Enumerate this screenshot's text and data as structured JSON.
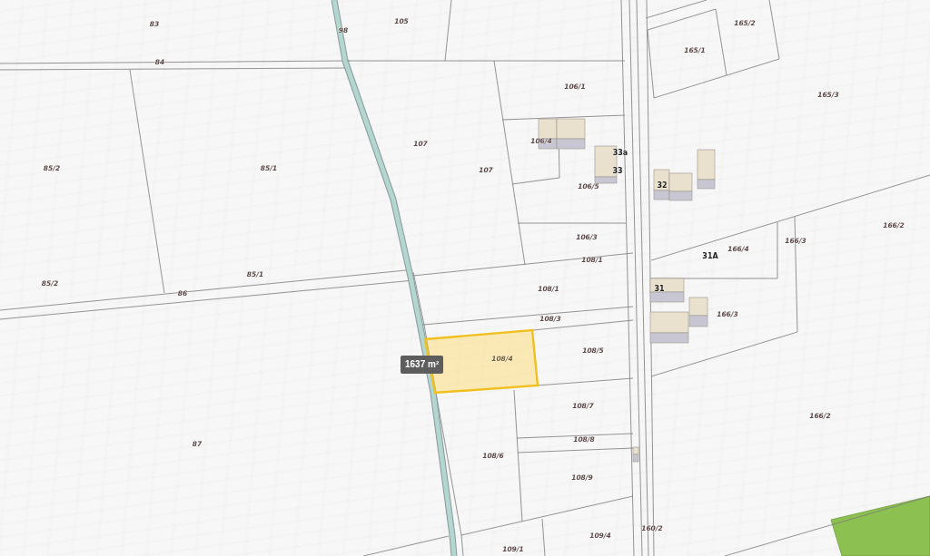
{
  "map": {
    "parcels": [
      {
        "label": "83",
        "selected": false
      },
      {
        "label": "105",
        "selected": false
      },
      {
        "label": "165/2",
        "selected": false
      },
      {
        "label": "98",
        "selected": false
      },
      {
        "label": "165/1",
        "selected": false
      },
      {
        "label": "84",
        "selected": false
      },
      {
        "label": "106/1",
        "selected": false
      },
      {
        "label": "165/3",
        "selected": false
      },
      {
        "label": "106/4",
        "selected": false
      },
      {
        "label": "107",
        "selected": false
      },
      {
        "label": "85/2",
        "selected": false
      },
      {
        "label": "85/1",
        "selected": false
      },
      {
        "label": "107",
        "selected": false
      },
      {
        "label": "106/5",
        "selected": false
      },
      {
        "label": "166/2",
        "selected": false
      },
      {
        "label": "106/3",
        "selected": false
      },
      {
        "label": "166/3",
        "selected": false
      },
      {
        "label": "166/4",
        "selected": false
      },
      {
        "label": "108/1",
        "selected": false
      },
      {
        "label": "85/1",
        "selected": false
      },
      {
        "label": "85/2",
        "selected": false
      },
      {
        "label": "108/1",
        "selected": false
      },
      {
        "label": "86",
        "selected": false
      },
      {
        "label": "166/3",
        "selected": false
      },
      {
        "label": "108/3",
        "selected": false
      },
      {
        "label": "108/5",
        "selected": false
      },
      {
        "label": "108/4",
        "selected": true
      },
      {
        "label": "108/7",
        "selected": false
      },
      {
        "label": "166/2",
        "selected": false
      },
      {
        "label": "108/8",
        "selected": false
      },
      {
        "label": "87",
        "selected": false
      },
      {
        "label": "108/6",
        "selected": false
      },
      {
        "label": "108/9",
        "selected": false
      },
      {
        "label": "160/2",
        "selected": false
      },
      {
        "label": "109/4",
        "selected": false
      },
      {
        "label": "109/1",
        "selected": false
      }
    ],
    "addresses": [
      {
        "number": "33a"
      },
      {
        "number": "33"
      },
      {
        "number": "32"
      },
      {
        "number": "31A"
      },
      {
        "number": "31"
      }
    ],
    "area_tooltip": "1637 m²"
  }
}
